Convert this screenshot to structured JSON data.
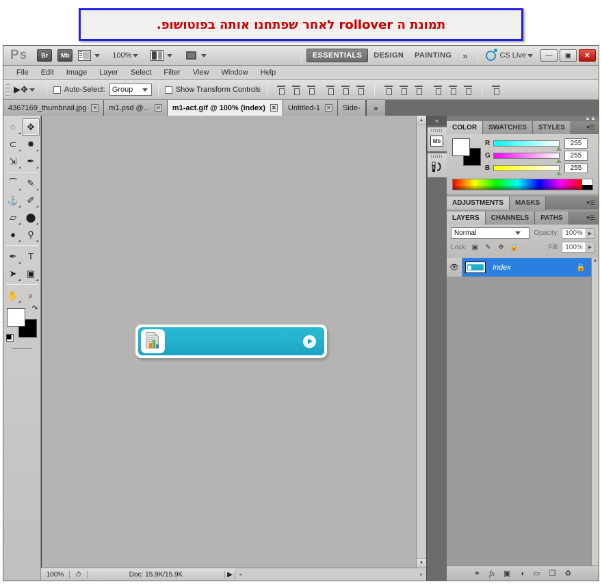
{
  "caption": {
    "text": "תמונת ה rollover לאחר שפתחנו אותה בפוטושופ.",
    "color": "#cc0000",
    "border_color": "#1e1ee6"
  },
  "app_bar": {
    "logo": "Ps",
    "bridge_button": "Br",
    "mini_bridge_button": "Mb",
    "screen_mode_icon": "screen-mode-icon",
    "zoom_level": "100%",
    "arrange_documents_icon": "arrange-documents-icon",
    "screen_mode_cycle_icon": "screen-mode-cycle-icon",
    "workspaces": [
      {
        "label": "ESSENTIALS",
        "active": true
      },
      {
        "label": "DESIGN",
        "active": false
      },
      {
        "label": "PAINTING",
        "active": false
      }
    ],
    "workspace_overflow": "»",
    "cs_live": "CS Live",
    "window_buttons": {
      "minimize": "—",
      "restore": "▣",
      "close": "✕"
    }
  },
  "menu_bar": {
    "items": [
      "File",
      "Edit",
      "Image",
      "Layer",
      "Select",
      "Filter",
      "View",
      "Window",
      "Help"
    ]
  },
  "options_bar": {
    "tool_icon": "move-tool-icon",
    "auto_select_label": "Auto-Select:",
    "auto_select_checked": false,
    "auto_select_target": "Group",
    "show_transform_label": "Show Transform Controls",
    "show_transform_checked": false,
    "align_icons": [
      "align-top-edges-icon",
      "align-vertical-centers-icon",
      "align-bottom-edges-icon",
      "align-left-edges-icon",
      "align-horizontal-centers-icon",
      "align-right-edges-icon"
    ],
    "distribute_icons": [
      "distribute-top-edges-icon",
      "distribute-vertical-centers-icon",
      "distribute-bottom-edges-icon",
      "distribute-left-edges-icon",
      "distribute-horizontal-centers-icon",
      "distribute-right-edges-icon"
    ],
    "auto_align_icon": "auto-align-layers-icon"
  },
  "document_tabs": [
    {
      "label": "4367169_thumbnail.jpg",
      "active": false,
      "close": "✕"
    },
    {
      "label": "m1.psd @...",
      "active": false,
      "close": "✕"
    },
    {
      "label": "m1-act.gif @ 100% (Index)",
      "active": true,
      "close": "✕"
    },
    {
      "label": "Untitled-1",
      "active": false,
      "close": "✕"
    },
    {
      "label": "Side-",
      "active": false,
      "close": ""
    }
  ],
  "tab_overflow": "»",
  "toolbar": {
    "tools": [
      {
        "name": "marquee-tool",
        "glyph": "◌",
        "selected": false
      },
      {
        "name": "move-tool",
        "glyph": "✥",
        "selected": true
      },
      {
        "name": "lasso-tool",
        "glyph": "⊂",
        "selected": false
      },
      {
        "name": "magic-wand-tool",
        "glyph": "✸",
        "selected": false
      },
      {
        "name": "crop-tool",
        "glyph": "⇲",
        "selected": false
      },
      {
        "name": "eyedropper-tool",
        "glyph": "✒",
        "selected": false
      },
      {
        "name": "spot-healing-brush-tool",
        "glyph": "⁀",
        "selected": false
      },
      {
        "name": "brush-tool",
        "glyph": "✎",
        "selected": false
      },
      {
        "name": "clone-stamp-tool",
        "glyph": "⚓",
        "selected": false
      },
      {
        "name": "history-brush-tool",
        "glyph": "✐",
        "selected": false
      },
      {
        "name": "eraser-tool",
        "glyph": "▱",
        "selected": false
      },
      {
        "name": "paint-bucket-tool",
        "glyph": "⬤",
        "selected": false
      },
      {
        "name": "blur-tool",
        "glyph": "●",
        "selected": false
      },
      {
        "name": "dodge-tool",
        "glyph": "⚲",
        "selected": false
      },
      {
        "name": "pen-tool",
        "glyph": "✒",
        "selected": false
      },
      {
        "name": "type-tool",
        "glyph": "T",
        "selected": false
      },
      {
        "name": "path-selection-tool",
        "glyph": "➤",
        "selected": false
      },
      {
        "name": "rectangle-tool",
        "glyph": "▣",
        "selected": false
      },
      {
        "name": "hand-tool",
        "glyph": "✋",
        "selected": false
      },
      {
        "name": "zoom-tool",
        "glyph": "⌕",
        "selected": false
      }
    ],
    "foreground_color": "#ffffff",
    "background_color": "#000000",
    "swap_colors_icon": "swap-colors-icon",
    "default_colors_icon": "default-colors-icon"
  },
  "canvas": {
    "rollover_button": {
      "name": "rollover-button-artwork",
      "fill_color": "#25b2cf",
      "plate_color": "#ffffff",
      "icon": "document-chart-icon",
      "arrow_icon": "arrow-right-circle-icon"
    }
  },
  "status_bar": {
    "zoom": "100%",
    "timing_icon": "timing-icon",
    "doc_info": "Doc: 15.9K/15.9K",
    "play_icon": "status-menu-arrow-icon",
    "scroll_left": "◂",
    "scroll_right": "▸"
  },
  "icon_dock": {
    "collapse_icon": "«",
    "items": [
      {
        "name": "mini-bridge-dock-icon",
        "label": "Mb"
      },
      {
        "name": "kuler-dock-icon",
        "label": ""
      }
    ]
  },
  "panels": {
    "color": {
      "tabs": [
        {
          "label": "COLOR",
          "active": true
        },
        {
          "label": "SWATCHES",
          "active": false
        },
        {
          "label": "STYLES",
          "active": false
        }
      ],
      "menu_icon": "panel-menu-icon",
      "foreground_color": "#ffffff",
      "background_color": "#000000",
      "channels": [
        {
          "label": "R",
          "value": "255"
        },
        {
          "label": "G",
          "value": "255"
        },
        {
          "label": "B",
          "value": "255"
        }
      ],
      "spectrum_name": "color-ramp"
    },
    "adjustments": {
      "tabs": [
        {
          "label": "ADJUSTMENTS",
          "active": true
        },
        {
          "label": "MASKS",
          "active": false
        }
      ],
      "menu_icon": "panel-menu-icon"
    },
    "layers": {
      "tabs": [
        {
          "label": "LAYERS",
          "active": true
        },
        {
          "label": "CHANNELS",
          "active": false
        },
        {
          "label": "PATHS",
          "active": false
        }
      ],
      "menu_icon": "panel-menu-icon",
      "blend_mode": "Normal",
      "opacity_label": "Opacity:",
      "opacity_value": "100%",
      "lock_label": "Lock:",
      "lock_icons": [
        "lock-transparent-pixels-icon",
        "lock-image-pixels-icon",
        "lock-position-icon",
        "lock-all-icon"
      ],
      "fill_label": "Fill:",
      "fill_value": "100%",
      "rows": [
        {
          "name": "Index",
          "visible": true,
          "locked": true,
          "selected": true,
          "eye_icon": "eye-icon",
          "lock_icon": "lock-icon"
        }
      ],
      "footer_icons": [
        {
          "name": "link-layers-icon",
          "glyph": "⚭"
        },
        {
          "name": "layer-style-icon",
          "glyph": "fx"
        },
        {
          "name": "layer-mask-icon",
          "glyph": "▣"
        },
        {
          "name": "new-fill-adjustment-icon",
          "glyph": "◑"
        },
        {
          "name": "new-group-icon",
          "glyph": "▭"
        },
        {
          "name": "new-layer-icon",
          "glyph": "❐"
        },
        {
          "name": "delete-layer-icon",
          "glyph": "♻"
        }
      ]
    }
  }
}
